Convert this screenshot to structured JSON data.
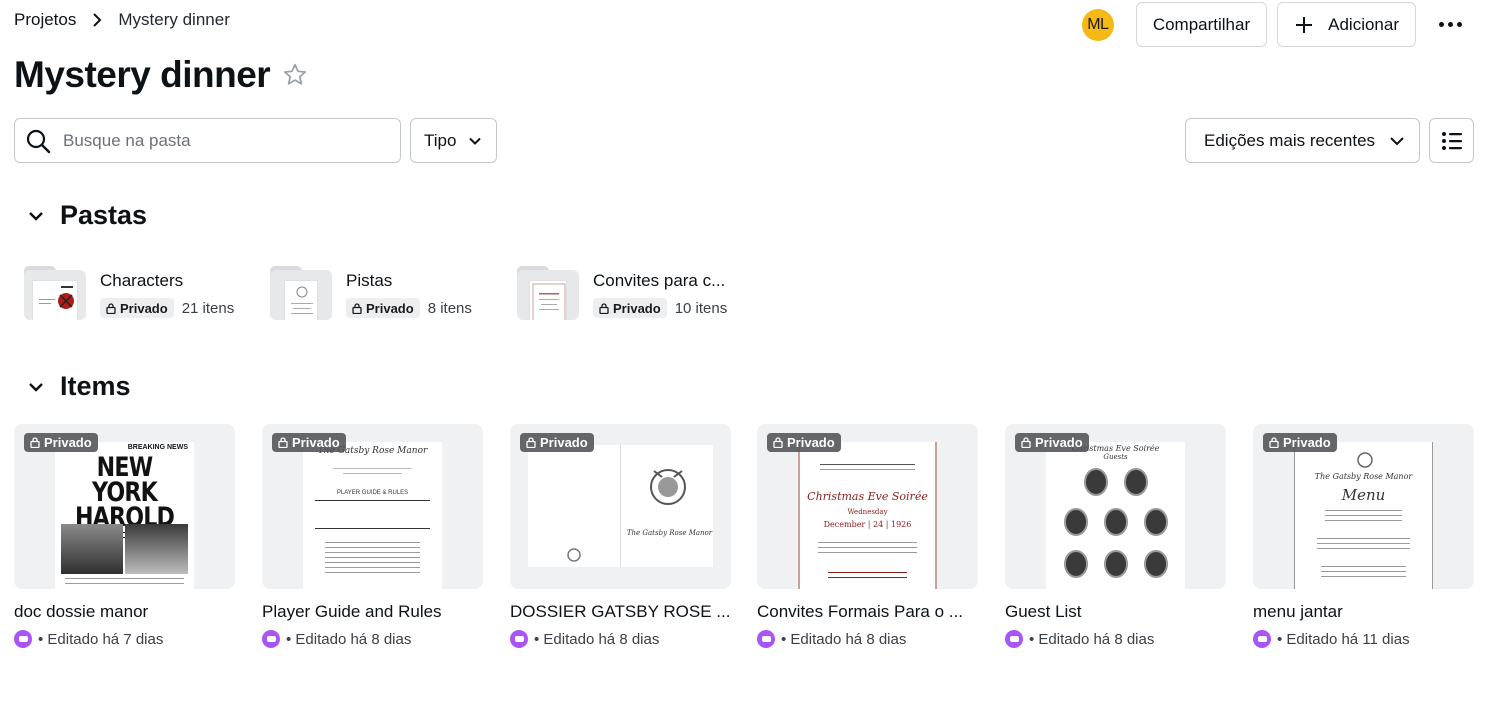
{
  "breadcrumb": {
    "root": "Projetos",
    "current": "Mystery dinner"
  },
  "header": {
    "avatar_initials": "ML",
    "share_label": "Compartilhar",
    "add_label": "Adicionar"
  },
  "page_title": "Mystery dinner",
  "filters": {
    "search_placeholder": "Busque na pasta",
    "type_label": "Tipo",
    "sort_label": "Edições mais recentes"
  },
  "sections": {
    "folders_label": "Pastas",
    "items_label": "Items"
  },
  "folders": [
    {
      "name": "Characters",
      "badge": "Privado",
      "count": "21 itens"
    },
    {
      "name": "Pistas",
      "badge": "Privado",
      "count": "8 itens"
    },
    {
      "name": "Convites para c...",
      "badge": "Privado",
      "count": "10 itens"
    }
  ],
  "items": [
    {
      "title": "doc dossie manor",
      "badge": "Privado",
      "meta": "• Editado há 7 dias"
    },
    {
      "title": "Player Guide and Rules",
      "badge": "Privado",
      "meta": "• Editado há 8 dias"
    },
    {
      "title": "DOSSIER GATSBY ROSE ...",
      "badge": "Privado",
      "meta": "• Editado há 8 dias"
    },
    {
      "title": "Convites Formais Para o ...",
      "badge": "Privado",
      "meta": "• Editado há 8 dias"
    },
    {
      "title": "Guest List",
      "badge": "Privado",
      "meta": "• Editado há 8 dias"
    },
    {
      "title": "menu jantar",
      "badge": "Privado",
      "meta": "• Editado há 11 dias"
    }
  ],
  "thumbs": {
    "newspaper_kicker": "BREAKING NEWS",
    "newspaper_title": "NEW YORK HAROLD",
    "manor_name": "The Gatsby Rose Manor",
    "player_guide": "PLAYER GUIDE & RULES",
    "invite_title": "Christmas Eve Soirée",
    "invite_day": "Wednesday",
    "invite_date": "December | 24 | 1926",
    "guest_title": "Christmas Eve Soirée",
    "guest_sub": "Guests",
    "menu_title": "Menu"
  },
  "colors": {
    "avatar": "#f5b915",
    "doc_type": "#a855f7"
  }
}
